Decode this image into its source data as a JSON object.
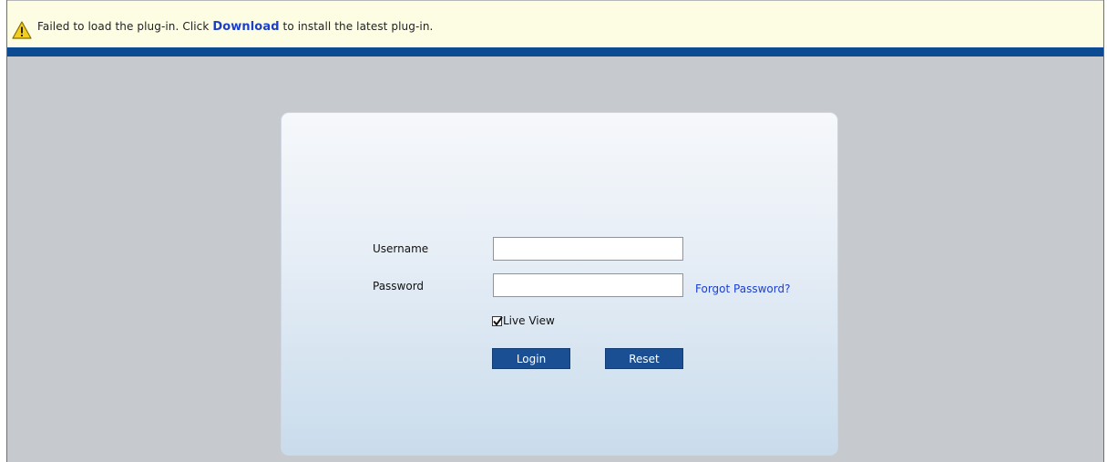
{
  "notice": {
    "text_before": "Failed to load the plug-in. Click ",
    "link_label": "Download",
    "text_after": " to install the latest plug-in.",
    "icon": "warning-icon"
  },
  "login": {
    "username_label": "Username",
    "username_value": "",
    "password_label": "Password",
    "password_value": "",
    "forgot_password_label": "Forgot Password?",
    "live_view_label": "Live View",
    "live_view_checked": true,
    "login_button_label": "Login",
    "reset_button_label": "Reset"
  },
  "colors": {
    "notice_bg": "#fdfde3",
    "accent_strip": "#0c4a92",
    "button_bg": "#1a5093",
    "link": "#1c3fd0",
    "page_bg": "#c6c9cd"
  }
}
